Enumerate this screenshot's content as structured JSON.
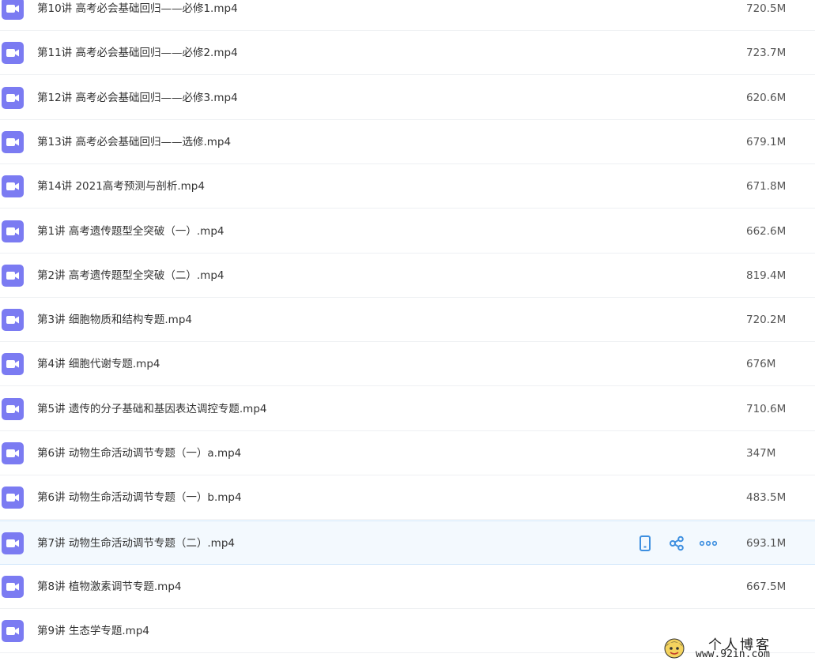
{
  "files": [
    {
      "name": "第10讲 高考必会基础回归——必修1.mp4",
      "size": "720.5M"
    },
    {
      "name": "第11讲 高考必会基础回归——必修2.mp4",
      "size": "723.7M"
    },
    {
      "name": "第12讲 高考必会基础回归——必修3.mp4",
      "size": "620.6M"
    },
    {
      "name": "第13讲 高考必会基础回归——选修.mp4",
      "size": "679.1M"
    },
    {
      "name": "第14讲 2021高考预测与剖析.mp4",
      "size": "671.8M"
    },
    {
      "name": "第1讲 高考遗传题型全突破（一）.mp4",
      "size": "662.6M"
    },
    {
      "name": "第2讲 高考遗传题型全突破（二）.mp4",
      "size": "819.4M"
    },
    {
      "name": "第3讲 细胞物质和结构专题.mp4",
      "size": "720.2M"
    },
    {
      "name": "第4讲 细胞代谢专题.mp4",
      "size": "676M"
    },
    {
      "name": "第5讲 遗传的分子基础和基因表达调控专题.mp4",
      "size": "710.6M"
    },
    {
      "name": "第6讲 动物生命活动调节专题（一）a.mp4",
      "size": "347M"
    },
    {
      "name": "第6讲 动物生命活动调节专题（一）b.mp4",
      "size": "483.5M"
    },
    {
      "name": "第7讲 动物生命活动调节专题（二）.mp4",
      "size": "693.1M"
    },
    {
      "name": "第8讲 植物激素调节专题.mp4",
      "size": "667.5M"
    },
    {
      "name": "第9讲 生态学专题.mp4",
      "size": ""
    }
  ],
  "hovered_index": 12,
  "actions": [
    {
      "icon": "phone-icon"
    },
    {
      "icon": "share-icon"
    },
    {
      "icon": "more-icon"
    }
  ],
  "watermark": {
    "title": "个人博客",
    "url": "www.92in.com"
  },
  "colors": {
    "video_icon": "#7b7bf2",
    "action_icon": "#3d8fe0",
    "hover_bg": "#f3f9fe"
  }
}
